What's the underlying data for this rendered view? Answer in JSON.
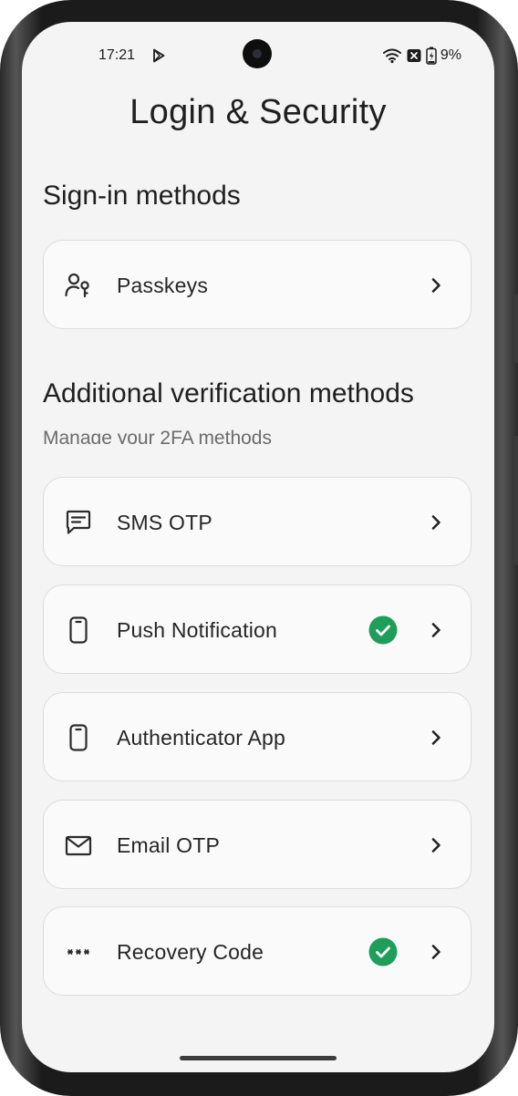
{
  "status_bar": {
    "time": "17:21",
    "battery": "9%"
  },
  "header": {
    "title": "Login & Security"
  },
  "sign_in": {
    "title": "Sign-in methods",
    "items": [
      {
        "label": "Passkeys",
        "icon": "passkey-icon",
        "enabled": false
      }
    ]
  },
  "verification": {
    "title": "Additional verification methods",
    "subtitle": "Manage your 2FA methods",
    "items": [
      {
        "label": "SMS OTP",
        "icon": "message-icon",
        "enabled": false
      },
      {
        "label": "Push Notification",
        "icon": "phone-icon",
        "enabled": true
      },
      {
        "label": "Authenticator App",
        "icon": "phone-icon",
        "enabled": false
      },
      {
        "label": "Email OTP",
        "icon": "mail-icon",
        "enabled": false
      },
      {
        "label": "Recovery Code",
        "icon": "asterisks-icon",
        "enabled": true
      }
    ]
  },
  "colors": {
    "background": "#f4f4f4",
    "card": "#fafafa",
    "check_green": "#1e9e5a",
    "text": "#1f1f1f"
  }
}
